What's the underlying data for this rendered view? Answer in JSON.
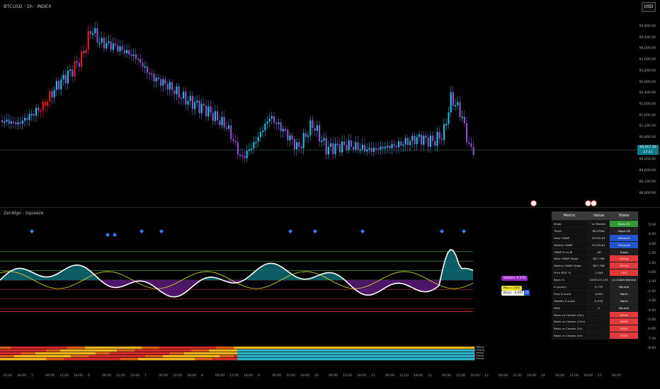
{
  "header": {
    "symbol_title": "BTCUSD · 1h · INDEX",
    "currency": "USD"
  },
  "price_axis": {
    "ticks": [
      "94,800.00",
      "94,400.00",
      "94,000.00",
      "93,600.00",
      "93,200.00",
      "92,800.00",
      "92,400.00",
      "92,000.00",
      "91,600.00",
      "91,200.00",
      "90,800.00",
      "90,400.00",
      "90,000.00",
      "89,600.00",
      "89,200.00",
      "88,800.00"
    ],
    "last_price": "90,917.49",
    "last_time": "17:41"
  },
  "indicator": {
    "title": "ZenAlgo - Squeeze",
    "axis_ticks": [
      "5.00",
      "4.00",
      "3.00",
      "2.00",
      "1.00",
      "0.00",
      "-1.00",
      "-2.00",
      "-3.00",
      "-4.00",
      "-5.00",
      "-6.00",
      "-7.00",
      "-8.00"
    ],
    "labels": {
      "stables": "Stables: 0.576",
      "perp": "Perp: z: -0.632",
      "basis": "Basis: -0.605"
    },
    "legend_rows": [
      "H Falling",
      "M Falling",
      "L Falling",
      "B Falling",
      "S Falling"
    ]
  },
  "table": {
    "headers": [
      "Metric",
      "Value",
      "State"
    ],
    "rows": [
      {
        "metric": "Mode",
        "value": "vs Stables",
        "state": "Basis OK"
      },
      {
        "metric": "Trend",
        "value": "NEUTRAL",
        "state": "Slope OK"
      },
      {
        "metric": "Daily VWAP",
        "value": "91355.81",
        "state": "Discount"
      },
      {
        "metric": "Weekly VWAP",
        "value": "91355.81",
        "state": "Discount"
      },
      {
        "metric": "VWAP D vs W",
        "value": ".00",
        "state": "Equal"
      },
      {
        "metric": "Daily VWAP Slope",
        "value": "607.796",
        "state": "Falling"
      },
      {
        "metric": "Weekly VWAP Slope",
        "value": "607.796",
        "state": "Falling"
      },
      {
        "metric": "Price ROC %",
        "value": "-1.605",
        "state": "RED"
      },
      {
        "metric": "Basis %",
        "value": "1059225.135",
        "state": "z=-0.605 Neutral"
      },
      {
        "metric": "Δ (proxy)",
        "value": "0.779",
        "state": "Neutral"
      },
      {
        "metric": "Perp Z-score",
        "value": "-0.632",
        "state": "Norm"
      },
      {
        "metric": "Stables Z-score",
        "value": "0.576",
        "state": "Norm"
      },
      {
        "metric": "BIAS",
        "value": "0",
        "state": "Neutral"
      },
      {
        "metric": "Basis vs Chosen (5m)",
        "value": "",
        "state": "BEAR"
      },
      {
        "metric": "Basis vs Chosen (15m)",
        "value": "",
        "state": "BEAR"
      },
      {
        "metric": "Basis vs Chosen (1h)",
        "value": "",
        "state": "BEAR"
      },
      {
        "metric": "Basis vs Chosen (4h)",
        "value": "",
        "state": "BEAR"
      }
    ]
  },
  "time_axis": [
    "12:00",
    "18:00",
    "5",
    "06:00",
    "12:00",
    "18:00",
    "6",
    "06:00",
    "12:00",
    "18:00",
    "7",
    "06:00",
    "12:00",
    "18:00",
    "8",
    "06:00",
    "12:00",
    "18:00",
    "9",
    "06:00",
    "12:00",
    "18:00",
    "10",
    "06:00",
    "12:00",
    "18:00",
    "11",
    "06:00",
    "12:00",
    "18:00",
    "12",
    "06:00",
    "12:00",
    "18:00",
    "13",
    "06:00",
    "12:00",
    "18:00",
    "14",
    "06:00",
    "12:00",
    "18:00",
    "15",
    "06:00"
  ],
  "colors": {
    "bull": "#29b6d8",
    "bear": "#8a4fc9",
    "strong": "#e21b1b",
    "teal_fill": "#0e6b73",
    "purple_fill": "#5a1a78"
  }
}
